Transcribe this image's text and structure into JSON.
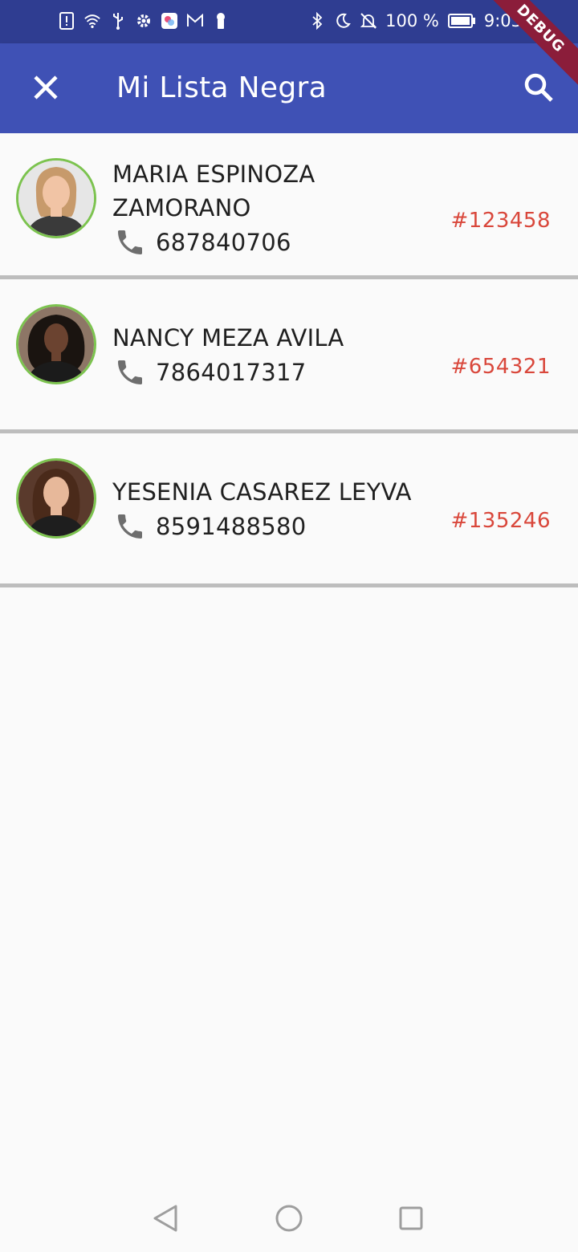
{
  "status_bar": {
    "battery": "100 %",
    "time": "9:03",
    "icons": [
      "alert-icon",
      "wifi-icon",
      "usb-icon",
      "gear-icon",
      "app-icon",
      "gmail-icon",
      "keyhole-icon",
      "bluetooth-icon",
      "moon-icon",
      "bell-off-icon",
      "battery-icon"
    ]
  },
  "app_bar": {
    "title": "Mi Lista Negra",
    "color": "#3f51b5"
  },
  "debug_label": "DEBUG",
  "contacts": [
    {
      "name": "MARIA ESPINOZA ZAMORANO",
      "phone": "687840706",
      "code": "#123458"
    },
    {
      "name": "NANCY MEZA AVILA",
      "phone": "7864017317",
      "code": "#654321"
    },
    {
      "name": "YESENIA CASAREZ LEYVA",
      "phone": "8591488580",
      "code": "#135246"
    }
  ],
  "colors": {
    "code_text": "#d9473b",
    "avatar_border": "#7cc34f",
    "divider": "#bdbdbd"
  }
}
